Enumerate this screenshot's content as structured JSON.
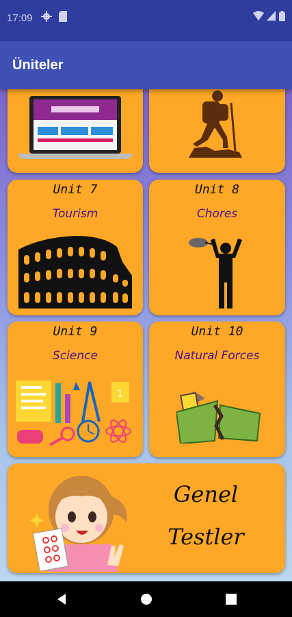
{
  "status_bar": {
    "time": "17:09"
  },
  "app_bar": {
    "title": "Üniteler"
  },
  "units": [
    {
      "number": "Unit 7",
      "name": "Tourism"
    },
    {
      "number": "Unit 8",
      "name": "Chores"
    },
    {
      "number": "Unit 9",
      "name": "Science"
    },
    {
      "number": "Unit 10",
      "name": "Natural Forces"
    }
  ],
  "tests_card": {
    "line1": "Genel",
    "line2": "Testler"
  },
  "colors": {
    "card": "#FFA726",
    "app_bar": "#3F51B5",
    "status_bar": "#2F3E9E",
    "unit_name": "#4a148c"
  },
  "icons": [
    "settings-icon",
    "sim-icon",
    "wifi-icon",
    "signal-icon",
    "battery-icon",
    "back-icon",
    "home-icon",
    "recents-icon"
  ]
}
